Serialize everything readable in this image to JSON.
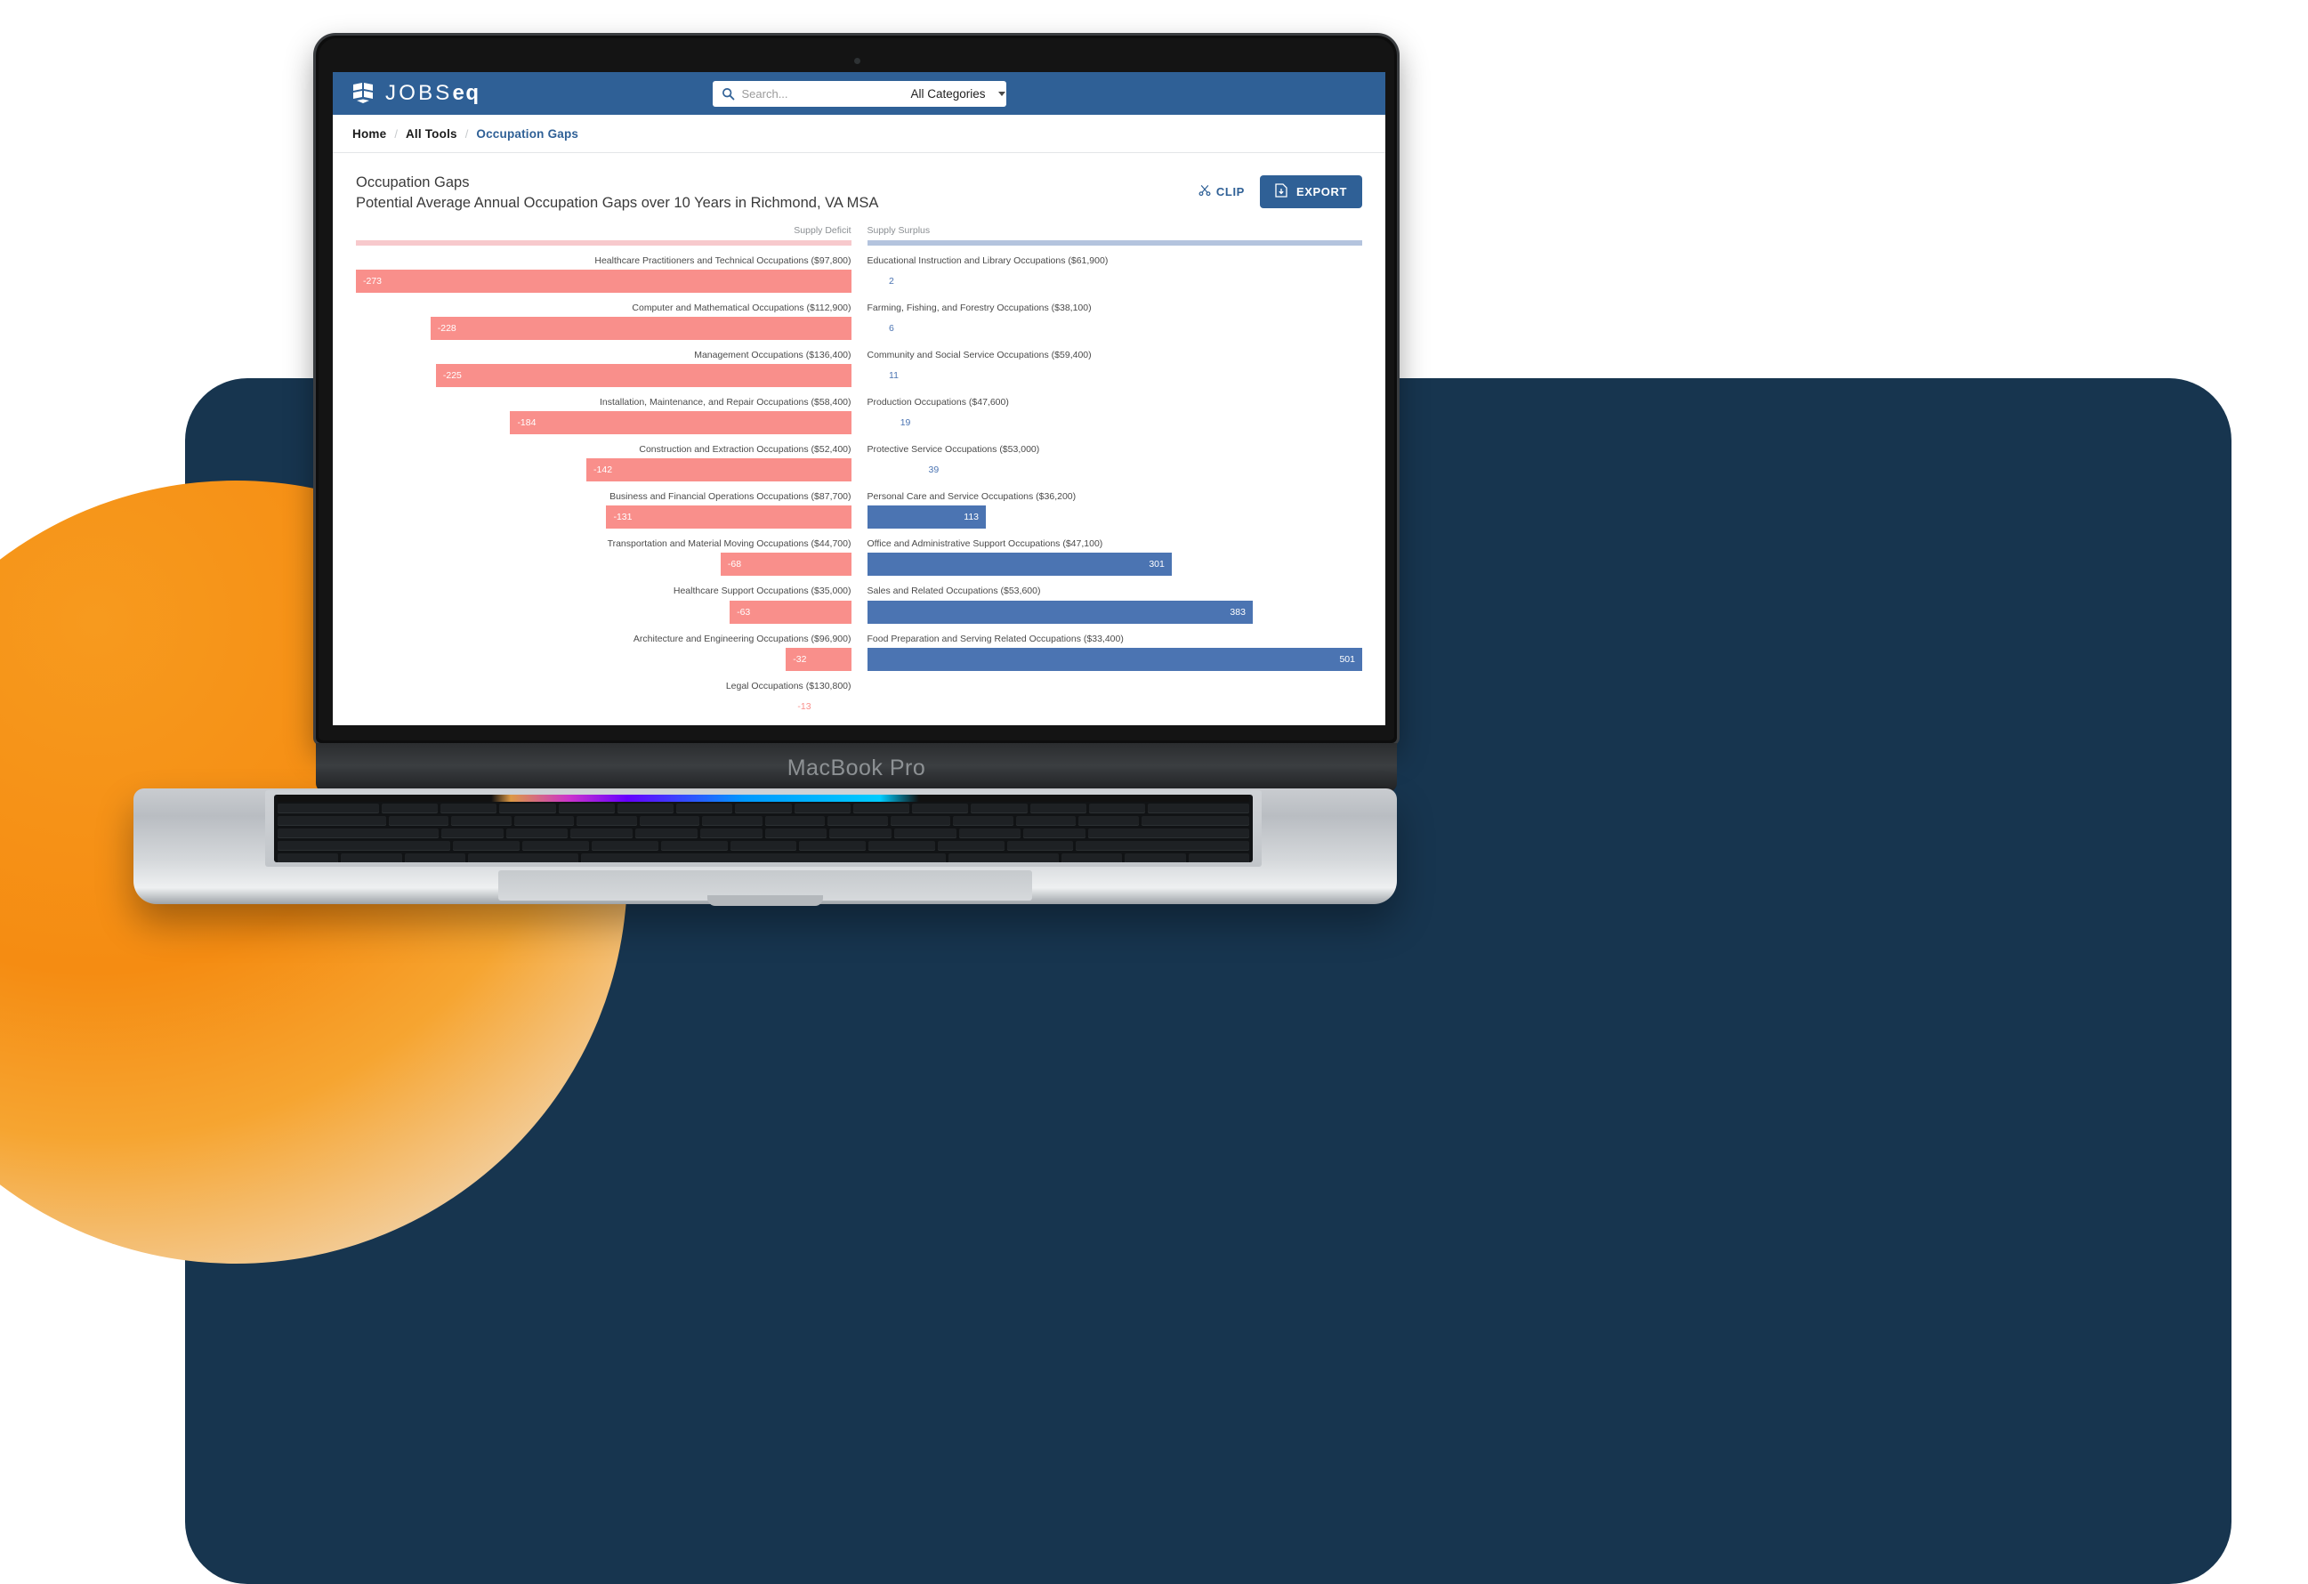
{
  "device": {
    "model_label": "MacBook Pro"
  },
  "app": {
    "brand": {
      "text_main": "JOBS",
      "text_accent": "eq",
      "icon": "jobseq-logo-icon"
    },
    "search": {
      "placeholder": "Search...",
      "value": "",
      "icon": "search-icon",
      "category_selected": "All Categories",
      "caret_icon": "chevron-down-icon"
    },
    "breadcrumb": {
      "items": [
        "Home",
        "All Tools",
        "Occupation Gaps"
      ],
      "separator": "/"
    },
    "header": {
      "title": "Occupation Gaps",
      "subtitle": "Potential Average Annual Occupation Gaps over 10 Years in Richmond, VA MSA"
    },
    "actions": {
      "clip_label": "CLIP",
      "clip_icon": "scissors-icon",
      "export_label": "EXPORT",
      "export_icon": "document-download-icon"
    },
    "colors": {
      "brand_blue": "#2f6096",
      "deficit_bar": "#f98f8b",
      "deficit_track": "#f7c9cc",
      "surplus_bar": "#4b74b2",
      "surplus_track": "#b4c4de",
      "backdrop_navy": "#17354f",
      "accent_orange": "#f58c12"
    }
  },
  "chart_data": {
    "type": "bar",
    "title": "Occupation Gaps",
    "subtitle": "Potential Average Annual Occupation Gaps over 10 Years in Richmond, VA MSA",
    "orientation": "horizontal",
    "xlabel": "",
    "ylabel": "",
    "grid": false,
    "legend_position": "top",
    "panels": [
      {
        "name": "Supply Deficit",
        "axis_label": "Supply Deficit",
        "color": "#f98f8b",
        "align": "right",
        "max_abs": 273,
        "categories": [
          "Healthcare Practitioners and Technical Occupations ($97,800)",
          "Computer and Mathematical Occupations ($112,900)",
          "Management Occupations ($136,400)",
          "Installation, Maintenance, and Repair Occupations ($58,400)",
          "Construction and Extraction Occupations ($52,400)",
          "Business and Financial Operations Occupations ($87,700)",
          "Transportation and Material Moving Occupations ($44,700)",
          "Healthcare Support Occupations ($35,000)",
          "Architecture and Engineering Occupations ($96,900)",
          "Legal Occupations ($130,800)"
        ],
        "values": [
          -273,
          -228,
          -225,
          -184,
          -142,
          -131,
          -68,
          -63,
          -32,
          -13
        ],
        "value_labels": [
          "-273",
          "-228",
          "-225",
          "-184",
          "-142",
          "-131",
          "-68",
          "-63",
          "-32",
          "-13"
        ],
        "wages": [
          "$97,800",
          "$112,900",
          "$136,400",
          "$58,400",
          "$52,400",
          "$87,700",
          "$44,700",
          "$35,000",
          "$96,900",
          "$130,800"
        ]
      },
      {
        "name": "Supply Surplus",
        "axis_label": "Supply Surplus",
        "color": "#4b74b2",
        "align": "left",
        "max_abs": 501,
        "categories": [
          "Educational Instruction and Library Occupations ($61,900)",
          "Farming, Fishing, and Forestry Occupations ($38,100)",
          "Community and Social Service Occupations ($59,400)",
          "Production Occupations ($47,600)",
          "Protective Service Occupations ($53,000)",
          "Personal Care and Service Occupations ($36,200)",
          "Office and Administrative Support Occupations ($47,100)",
          "Sales and Related Occupations ($53,600)",
          "Food Preparation and Serving Related Occupations ($33,400)"
        ],
        "values": [
          2,
          6,
          11,
          19,
          39,
          113,
          301,
          383,
          501
        ],
        "value_labels": [
          "2",
          "6",
          "11",
          "19",
          "39",
          "113",
          "301",
          "383",
          "501"
        ],
        "wages": [
          "$61,900",
          "$38,100",
          "$59,400",
          "$47,600",
          "$53,000",
          "$36,200",
          "$47,100",
          "$53,600",
          "$33,400"
        ]
      }
    ]
  }
}
